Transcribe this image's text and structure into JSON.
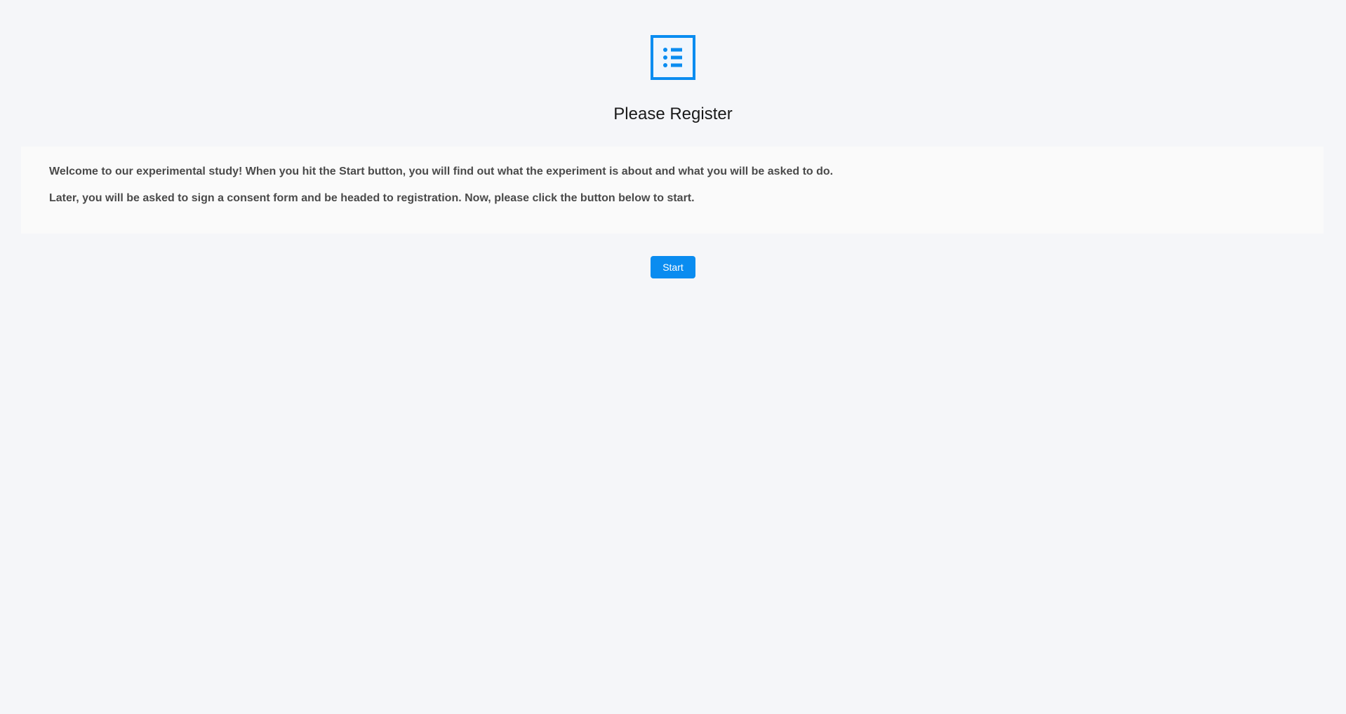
{
  "header": {
    "icon": "list-icon",
    "title": "Please Register"
  },
  "info": {
    "line1": "Welcome to our experimental study! When you hit the Start button, you will find out what the experiment is about and what you will be asked to do.",
    "line2": "Later, you will be asked to sign a consent form and be headed to registration. Now, please click the button below to start."
  },
  "actions": {
    "start_label": "Start"
  },
  "colors": {
    "accent": "#0a8cf0",
    "background": "#f5f6f9",
    "panel": "#fafafa",
    "text": "#4a4a4a"
  }
}
